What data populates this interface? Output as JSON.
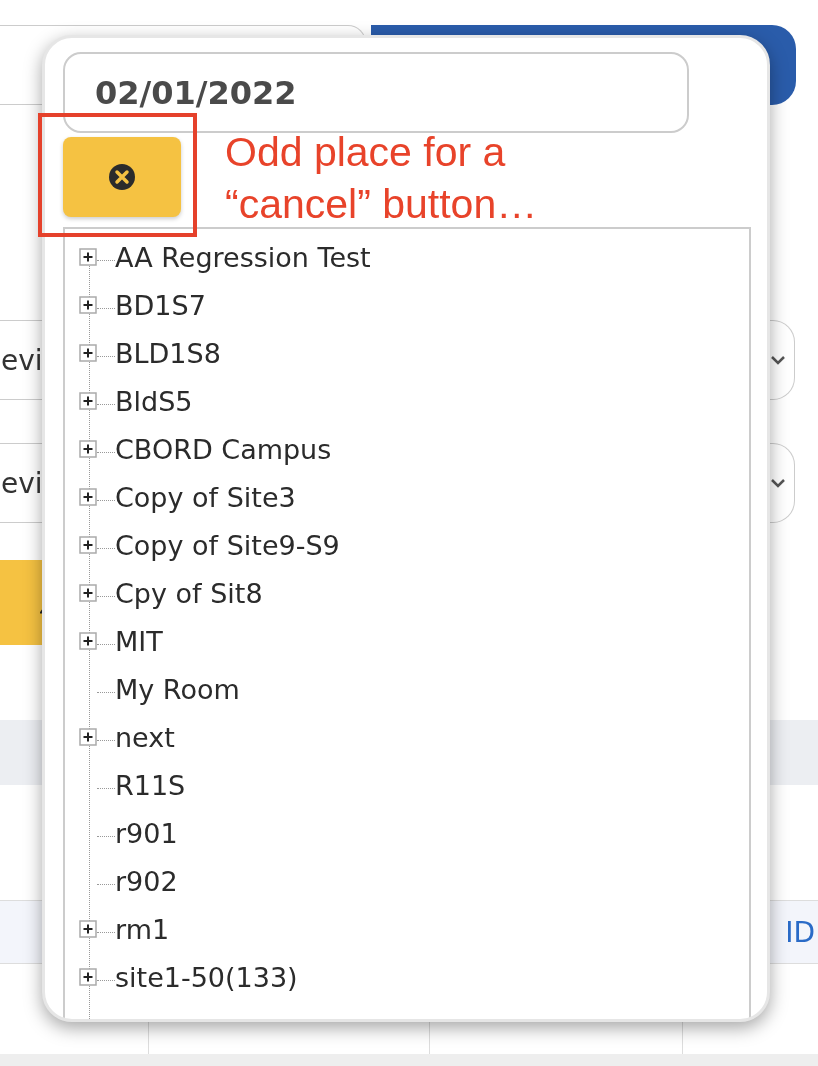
{
  "background": {
    "selects": [
      {
        "value": "evi"
      },
      {
        "value": "evi"
      }
    ],
    "table_link": "ID"
  },
  "popup": {
    "date_field": {
      "value": "02/01/2022"
    },
    "tree": [
      {
        "label": "AA Regression Test",
        "expandable": true
      },
      {
        "label": "BD1S7",
        "expandable": true
      },
      {
        "label": "BLD1S8",
        "expandable": true
      },
      {
        "label": "BldS5",
        "expandable": true
      },
      {
        "label": "CBORD Campus",
        "expandable": true
      },
      {
        "label": "Copy of Site3",
        "expandable": true
      },
      {
        "label": "Copy of Site9-S9",
        "expandable": true
      },
      {
        "label": "Cpy of Sit8",
        "expandable": true
      },
      {
        "label": "MIT",
        "expandable": true
      },
      {
        "label": "My Room",
        "expandable": false
      },
      {
        "label": "next",
        "expandable": true
      },
      {
        "label": "R11S",
        "expandable": false
      },
      {
        "label": "r901",
        "expandable": false
      },
      {
        "label": "r902",
        "expandable": false
      },
      {
        "label": "rm1",
        "expandable": true
      },
      {
        "label": "site1-50(133)",
        "expandable": true
      }
    ]
  },
  "annotation": {
    "text": "Odd place for a “cancel” button…"
  }
}
